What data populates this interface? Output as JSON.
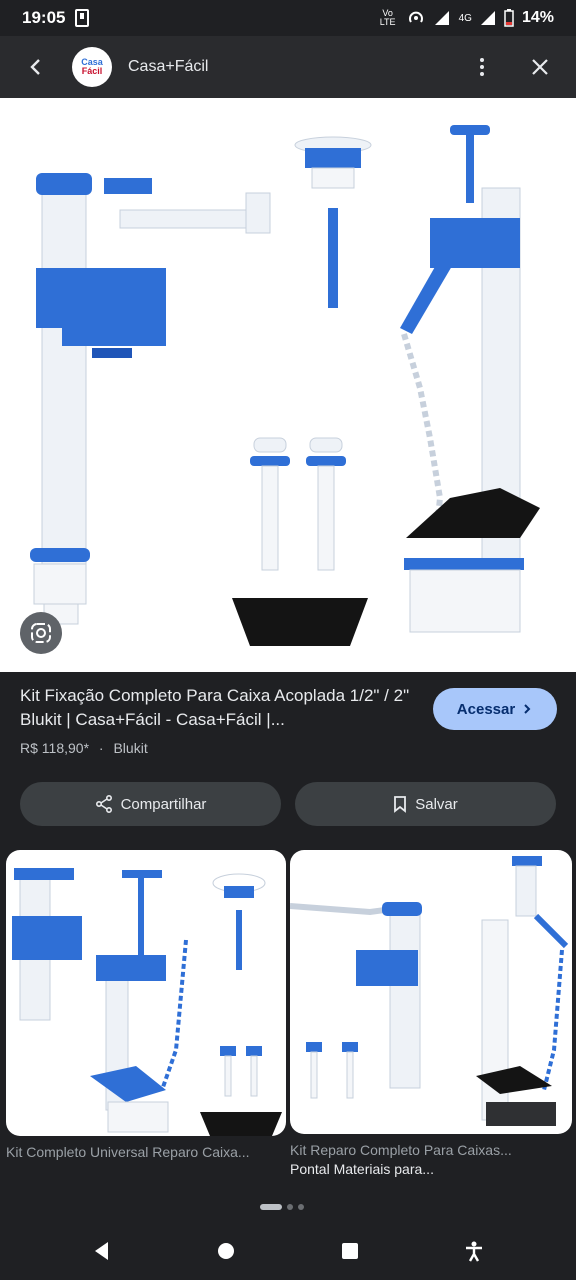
{
  "status_bar": {
    "time": "19:05",
    "network": "Vo LTE",
    "signal": "4G",
    "battery": "14%"
  },
  "app_bar": {
    "logo_text_top": "Casa",
    "logo_text_bottom": "Fácil",
    "site_name": "Casa+Fácil"
  },
  "product": {
    "title": "Kit Fixação Completo Para Caixa Acoplada 1/2\" / 2\" Blukit | Casa+Fácil - Casa+Fácil |...",
    "price": "R$ 118,90*",
    "separator": "·",
    "brand": "Blukit",
    "visit_label": "Acessar"
  },
  "actions": {
    "share_label": "Compartilhar",
    "save_label": "Salvar"
  },
  "related": [
    {
      "caption": "Kit Completo Universal Reparo Caixa...",
      "source": ""
    },
    {
      "caption": "Kit Reparo Completo Para Caixas...",
      "source": "Pontal Materiais para..."
    }
  ],
  "colors": {
    "accent_blue": "#2f6fd6",
    "button_blue": "#a8c7fa",
    "background": "#1f2023"
  }
}
